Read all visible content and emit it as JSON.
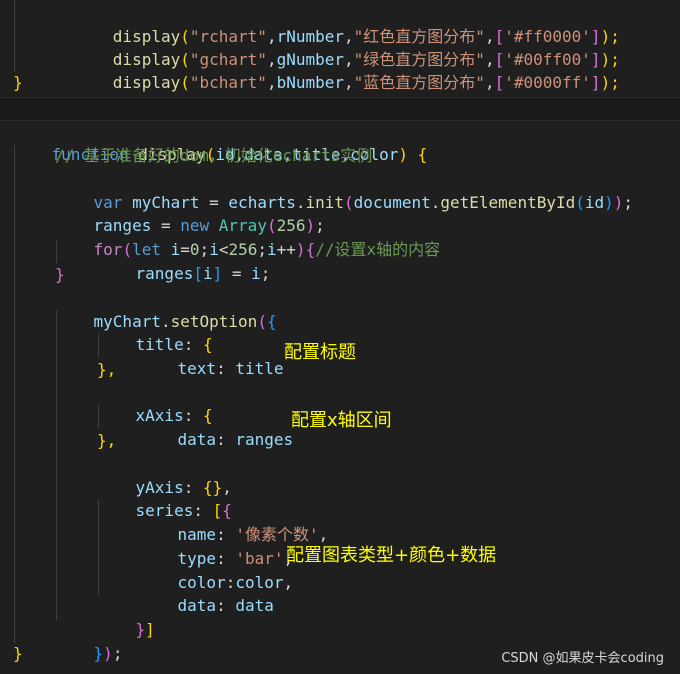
{
  "top_code": {
    "line1": {
      "fn": "display",
      "p1": "(",
      "arg1": "\"rchart\"",
      "c1": ",",
      "arg2": "rNumber",
      "c2": ",",
      "arg3": "\"红色直方图分布\"",
      "c3": ",",
      "b1": "[",
      "arg4": "'#ff0000'",
      "b2": "]",
      "p2": ");"
    },
    "line2": {
      "fn": "display",
      "p1": "(",
      "arg1": "\"gchart\"",
      "c1": ",",
      "arg2": "gNumber",
      "c2": ",",
      "arg3": "\"绿色直方图分布\"",
      "c3": ",",
      "b1": "[",
      "arg4": "'#00ff00'",
      "b2": "]",
      "p2": ");"
    },
    "line3": {
      "fn": "display",
      "p1": "(",
      "arg1": "\"bchart\"",
      "c1": ",",
      "arg2": "bNumber",
      "c2": ",",
      "arg3": "\"蓝色直方图分布\"",
      "c3": ",",
      "b1": "[",
      "arg4": "'#0000ff'",
      "b2": "]",
      "p2": ");"
    },
    "line4": "}"
  },
  "code": {
    "l1": {
      "kw": "function",
      "name": "display",
      "open": "(",
      "params": "id,data,title,color",
      "close": ")",
      "brace": "{"
    },
    "l2": "// 基于准备好的dom，初始化echarts实例",
    "l3": {
      "kw": "var",
      "name": "myChart",
      "eq": " = ",
      "obj": "echarts",
      "dot": ".",
      "method": "init",
      "p1": "(",
      "doc": "document",
      "dot2": ".",
      "method2": "getElementById",
      "p2": "(",
      "arg": "id",
      "p3": ")",
      "p4": ")",
      "semi": ";"
    },
    "l4": {
      "name": "ranges",
      "eq": " = ",
      "kw": "new",
      "cls": "Array",
      "p1": "(",
      "num": "256",
      "p2": ")",
      "semi": ";"
    },
    "l5": {
      "kw": "for",
      "p1": "(",
      "kw2": "let",
      "v": "i",
      "eq": "=",
      "n0": "0",
      "s1": ";",
      "v2": "i",
      "lt": "<",
      "n256": "256",
      "s2": ";",
      "v3": "i",
      "pp": "++",
      "p2": ")",
      "brace": "{",
      "cmt": "//设置x轴的内容"
    },
    "l6": {
      "name": "ranges",
      "b1": "[",
      "idx": "i",
      "b2": "]",
      "eq": " = ",
      "val": "i",
      "semi": ";"
    },
    "l7": "}",
    "l8": {
      "obj": "myChart",
      "dot": ".",
      "method": "setOption",
      "p": "(",
      "brace": "{"
    },
    "l9": {
      "key": "title",
      "colon": ": ",
      "brace": "{"
    },
    "l10": {
      "key": "text",
      "colon": ": ",
      "val": "title"
    },
    "l11": "},",
    "l12": {
      "key": "xAxis",
      "colon": ": ",
      "brace": "{"
    },
    "l13": {
      "key": "data",
      "colon": ": ",
      "val": "ranges"
    },
    "l14": "},",
    "l15": {
      "key": "yAxis",
      "colon": ": ",
      "brace": "{}",
      "comma": ","
    },
    "l16": {
      "key": "series",
      "colon": ": ",
      "b": "[",
      "brace": "{"
    },
    "l17": {
      "key": "name",
      "colon": ": ",
      "val": "'像素个数'",
      "comma": ","
    },
    "l18": {
      "key": "type",
      "colon": ": ",
      "val": "'bar'",
      "comma": ","
    },
    "l19": {
      "key": "color",
      "colon": ":",
      "val": "color",
      "comma": ","
    },
    "l20": {
      "key": "data",
      "colon": ": ",
      "val": "data"
    },
    "l21": {
      "brace": "}",
      "b": "]"
    },
    "l22": {
      "brace": "}",
      "p": ")",
      "semi": ";"
    },
    "l23": "}"
  },
  "annotations": {
    "title_note": "配置标题",
    "xaxis_note": "配置x轴区间",
    "series_note": "配置图表类型+颜色+数据"
  },
  "watermark": "CSDN @如果皮卡会coding",
  "colors": {
    "background": "#1f1f1f",
    "keyword": "#569cd6",
    "control": "#c586c0",
    "function": "#dcdcaa",
    "string": "#ce9178",
    "variable": "#9cdcfe",
    "comment": "#6a9955",
    "annotation": "#ffff00"
  }
}
